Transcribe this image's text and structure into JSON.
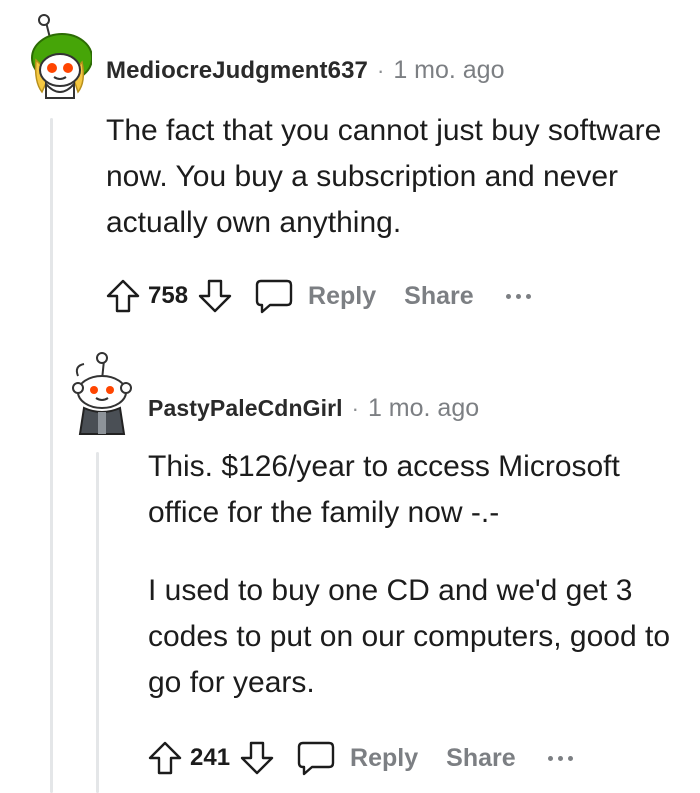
{
  "comments": [
    {
      "author": "MediocreJudgment637",
      "separator": "·",
      "time": "1 mo. ago",
      "paragraphs": [
        "The fact that you cannot just buy software now. You buy a subscription and never actually own anything."
      ],
      "score": "758",
      "reply_label": "Reply",
      "share_label": "Share"
    },
    {
      "author": "PastyPaleCdnGirl",
      "separator": "·",
      "time": "1 mo. ago",
      "paragraphs": [
        "This. $126/year to access Microsoft office for the family now -.-",
        "I used to buy one CD and we'd get 3 codes to put on our computers, good to go for years."
      ],
      "score": "241",
      "reply_label": "Reply",
      "share_label": "Share"
    }
  ],
  "colors": {
    "text": "#1c1c1c",
    "muted": "#7c7f83",
    "thread_line": "#e4e6e8",
    "avatar1_green": "#46a508",
    "avatar1_hair": "#f5c842"
  },
  "icons": [
    "upvote-icon",
    "downvote-icon",
    "comment-icon",
    "more-options-icon"
  ]
}
